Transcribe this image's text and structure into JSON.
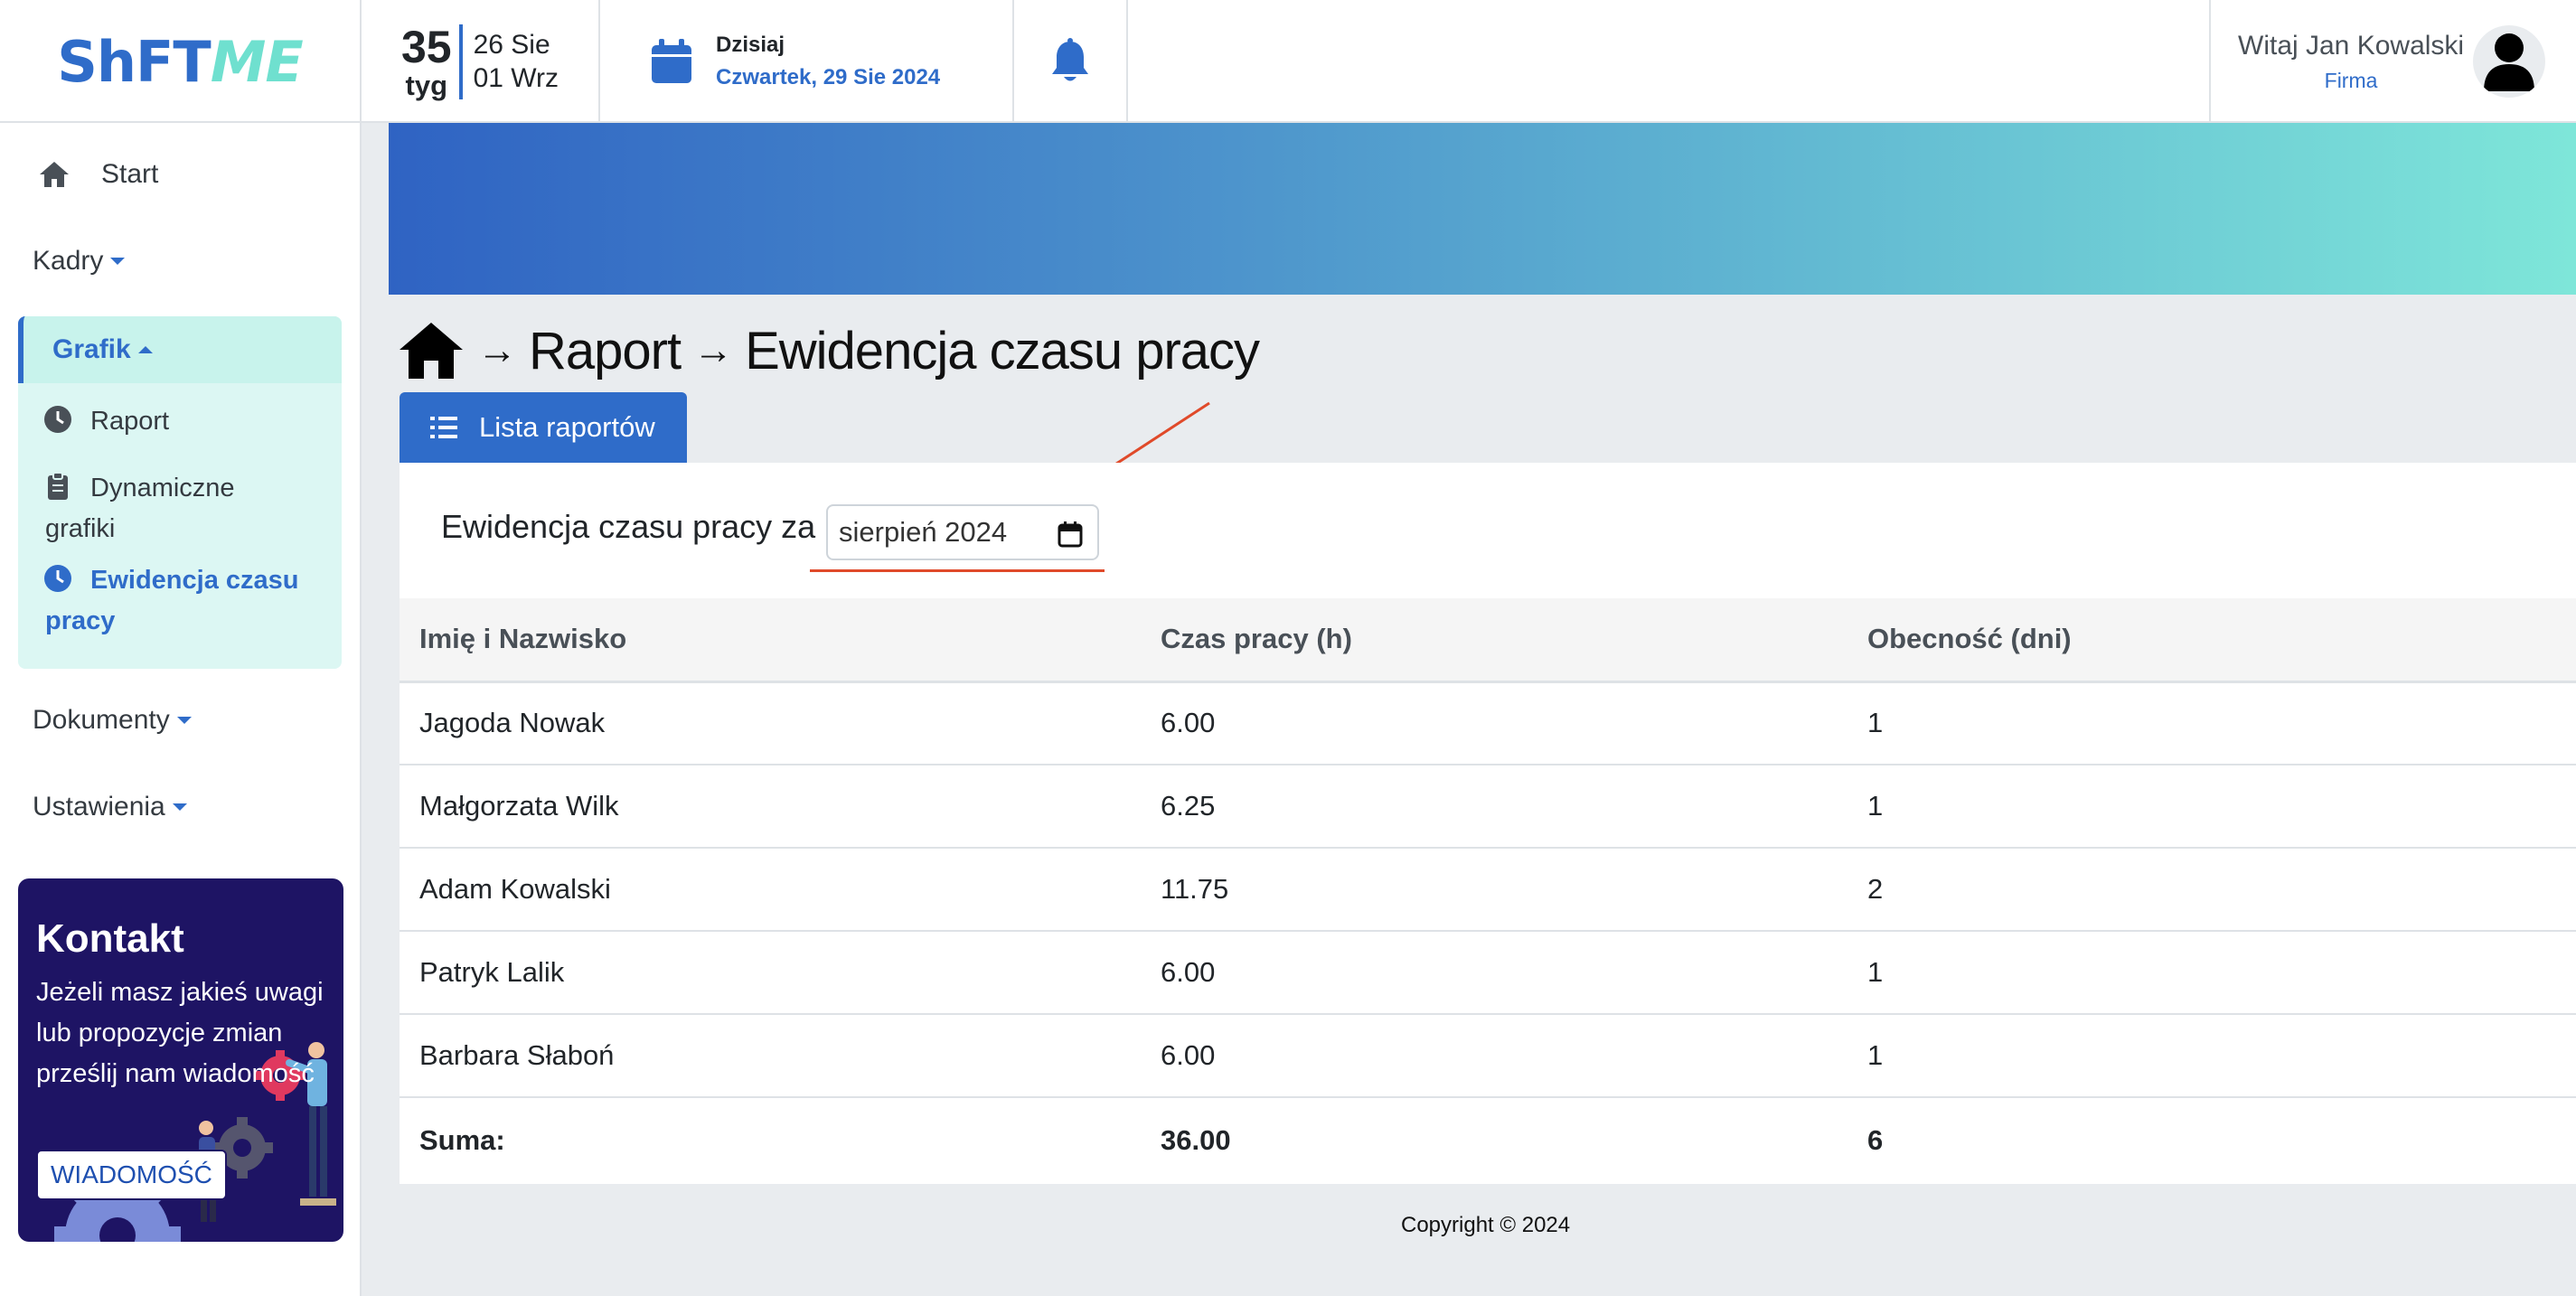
{
  "brand": {
    "logo_part1": "ShFT",
    "logo_part2": "ME"
  },
  "week": {
    "number": "35",
    "label": "tyg",
    "range_start": "26 Sie",
    "range_end": "01 Wrz"
  },
  "today": {
    "label": "Dzisiaj",
    "date": "Czwartek, 29 Sie 2024"
  },
  "user": {
    "greeting": "Witaj Jan Kowalski",
    "company": "Firma"
  },
  "sidebar": {
    "start": "Start",
    "kadry": "Kadry",
    "grafik": "Grafik",
    "grafik_items": [
      {
        "label": "Raport"
      },
      {
        "label_line1": "Dynamiczne",
        "label_line2": "grafiki"
      },
      {
        "label_line1": "Ewidencja czasu",
        "label_line2": "pracy"
      }
    ],
    "dokumenty": "Dokumenty",
    "ustawienia": "Ustawienia"
  },
  "contact": {
    "title": "Kontakt",
    "text": "Jeżeli masz jakieś uwagi lub propozycje zmian prześlij nam wiadomość",
    "button": "WIADOMOŚĆ"
  },
  "breadcrumb": {
    "level1": "Raport",
    "level2": "Ewidencja czasu pracy"
  },
  "tab": {
    "label": "Lista raportów"
  },
  "filter": {
    "label": "Ewidencja czasu pracy za",
    "month_value": "sierpień 2024"
  },
  "table": {
    "headers": [
      "Imię i Nazwisko",
      "Czas pracy (h)",
      "Obecność (dni)"
    ],
    "rows": [
      [
        "Jagoda Nowak",
        "6.00",
        "1"
      ],
      [
        "Małgorzata Wilk",
        "6.25",
        "1"
      ],
      [
        "Adam Kowalski",
        "11.75",
        "2"
      ],
      [
        "Patryk Lalik",
        "6.00",
        "1"
      ],
      [
        "Barbara Słaboń",
        "6.00",
        "1"
      ]
    ],
    "sum": [
      "Suma:",
      "36.00",
      "6"
    ]
  },
  "footer": {
    "copyright": "Copyright © 2024"
  },
  "colors": {
    "accent": "#2f6cc9",
    "teal": "#7ee6d9",
    "contact_bg": "#1e1464",
    "annotation": "#e04a2a"
  }
}
